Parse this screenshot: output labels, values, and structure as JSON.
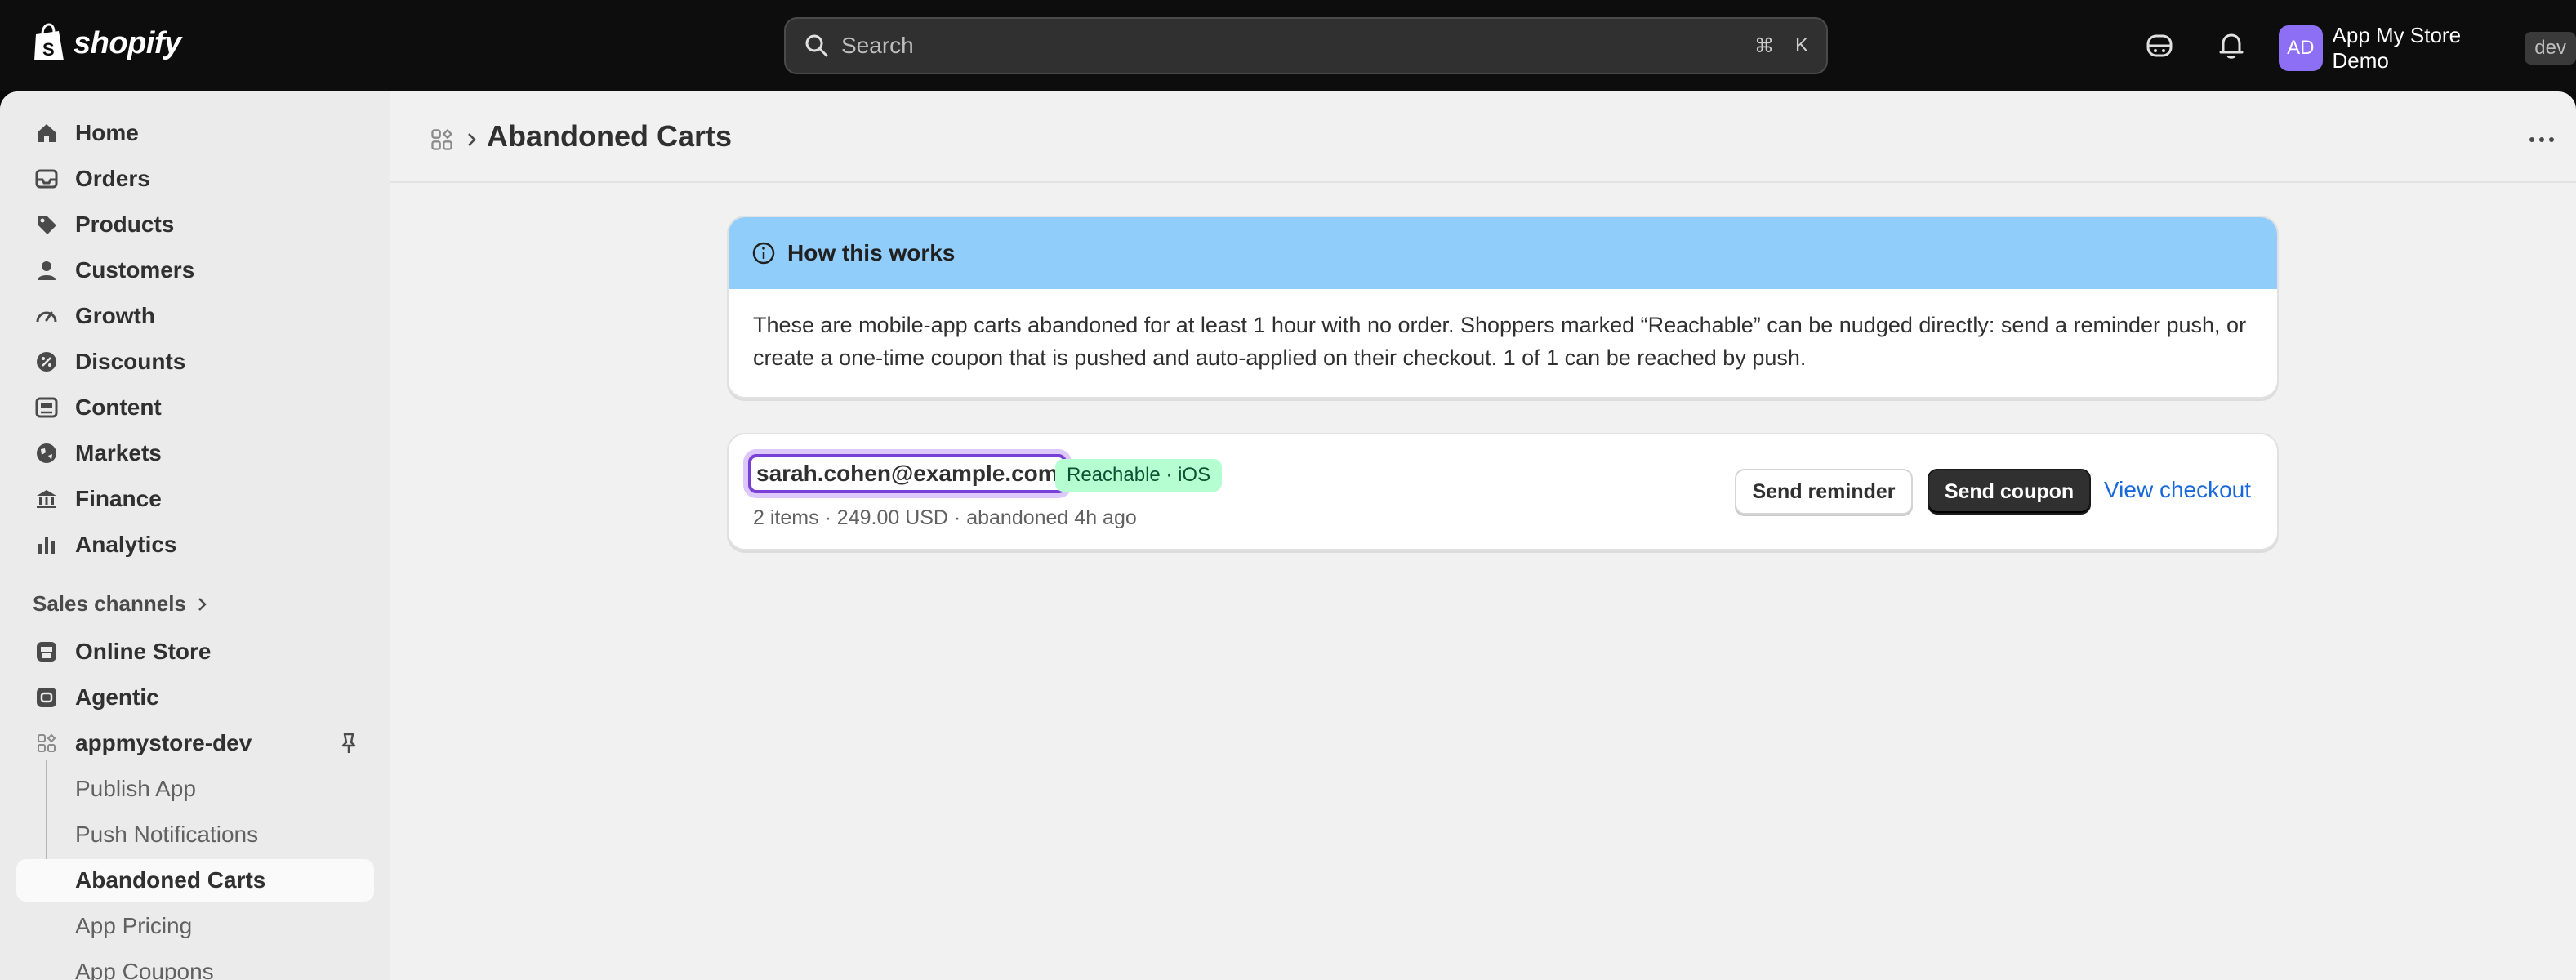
{
  "topbar": {
    "brand": "shopify",
    "search_placeholder": "Search",
    "shortcut_cmd": "⌘",
    "shortcut_key": "K",
    "avatar_initials": "AD",
    "store_name": "App My Store Demo",
    "env_badge": "dev"
  },
  "sidebar": {
    "items": [
      {
        "label": "Home"
      },
      {
        "label": "Orders"
      },
      {
        "label": "Products"
      },
      {
        "label": "Customers"
      },
      {
        "label": "Growth"
      },
      {
        "label": "Discounts"
      },
      {
        "label": "Content"
      },
      {
        "label": "Markets"
      },
      {
        "label": "Finance"
      },
      {
        "label": "Analytics"
      }
    ],
    "sales_channels_label": "Sales channels",
    "channels": [
      {
        "label": "Online Store"
      },
      {
        "label": "Agentic"
      },
      {
        "label": "appmystore-dev"
      }
    ],
    "app_pages": [
      {
        "label": "Publish App"
      },
      {
        "label": "Push Notifications"
      },
      {
        "label": "Abandoned Carts"
      },
      {
        "label": "App Pricing"
      },
      {
        "label": "App Coupons"
      }
    ],
    "active": "Abandoned Carts"
  },
  "page": {
    "title": "Abandoned Carts"
  },
  "info_banner": {
    "title": "How this works",
    "body": "These are mobile-app carts abandoned for at least 1 hour with no order. Shoppers marked “Reachable” can be nudged directly: send a reminder push, or create a one-time coupon that is pushed and auto-applied on their checkout. 1 of 1 can be reached by push."
  },
  "carts": [
    {
      "email": "sarah.cohen@example.com",
      "badge": "Reachable · iOS",
      "meta": "2 items · 249.00 USD · abandoned 4h ago",
      "send_reminder_label": "Send reminder",
      "send_coupon_label": "Send coupon",
      "view_checkout_label": "View checkout"
    }
  ],
  "colors": {
    "banner_bg": "#91cdfb",
    "badge_bg": "#b4fed2",
    "focus_ring": "#7a3fd6",
    "link": "#1868db",
    "avatar": "#8d6ff5"
  }
}
